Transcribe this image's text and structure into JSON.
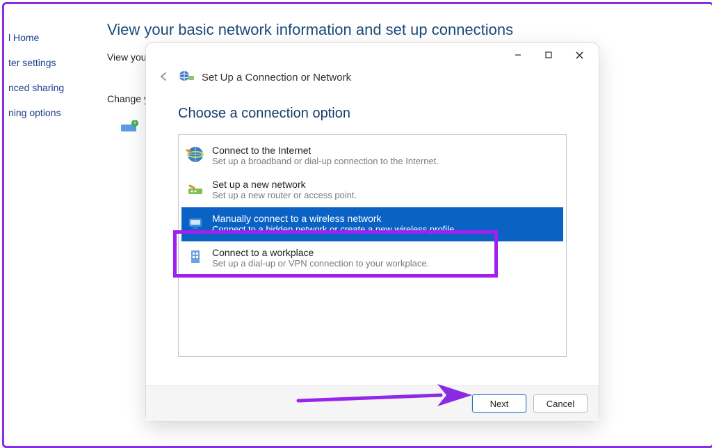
{
  "sidebar": {
    "items": [
      {
        "label": "l Home"
      },
      {
        "label": "ter settings"
      },
      {
        "label": "nced sharing"
      },
      {
        "label": "ning options"
      }
    ]
  },
  "controlpanel": {
    "title": "View your basic network information and set up connections",
    "view_line": "View you",
    "change_line": "Change y"
  },
  "dialog": {
    "header": "Set Up a Connection or Network",
    "heading": "Choose a connection option",
    "options": [
      {
        "title": "Connect to the Internet",
        "desc": "Set up a broadband or dial-up connection to the Internet."
      },
      {
        "title": "Set up a new network",
        "desc": "Set up a new router or access point."
      },
      {
        "title": "Manually connect to a wireless network",
        "desc": "Connect to a hidden network or create a new wireless profile"
      },
      {
        "title": "Connect to a workplace",
        "desc": "Set up a dial-up or VPN connection to your workplace."
      }
    ],
    "buttons": {
      "next": "Next",
      "cancel": "Cancel"
    }
  }
}
